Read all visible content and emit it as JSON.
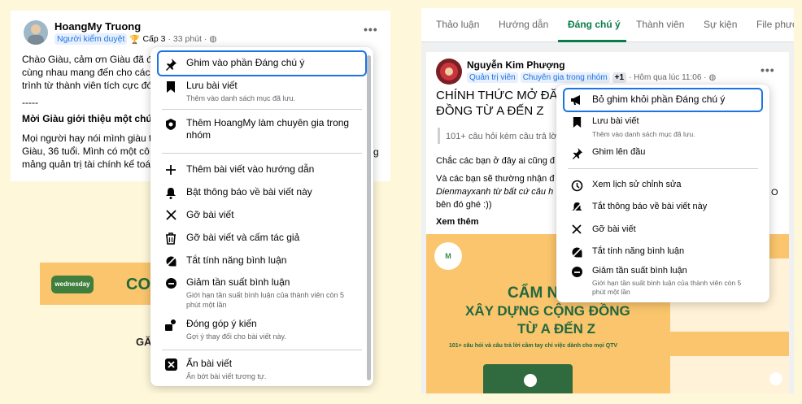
{
  "left": {
    "author": "HoangMy Truong",
    "role_badge": "Người kiểm duyệt",
    "level": "Cấp 3",
    "time": "· 33 phút ·",
    "body_lines": [
      "Chào Giàu, cảm ơn Giàu đã đ",
      "cùng nhau mang đến cho các",
      "trình từ thành viên tích cực đó"
    ],
    "divider": "-----",
    "intro_heading": "Mời Giàu giới thiệu một chút",
    "intro_lines": [
      "Mọi người hay nói mình giàu t",
      "Giàu, 36 tuổi. Mình có một cô",
      "mảng quản trị tài chính kế toá"
    ],
    "overflow_char": "g",
    "art_badge": "wednesday",
    "art_text": "CO",
    "art_text2": "GĂ",
    "menu": [
      {
        "icon": "pin-icon",
        "label": "Ghim vào phần Đáng chú ý",
        "sub": ""
      },
      {
        "icon": "bookmark-icon",
        "label": "Lưu bài viết",
        "sub": "Thêm vào danh sách mục đã lưu."
      },
      {
        "icon": "expert-badge-icon",
        "label": "Thêm HoangMy làm chuyên gia trong nhóm",
        "sub": ""
      },
      {
        "icon": "plus-icon",
        "label": "Thêm bài viết vào hướng dẫn",
        "sub": ""
      },
      {
        "icon": "bell-icon",
        "label": "Bật thông báo về bài viết này",
        "sub": ""
      },
      {
        "icon": "x-icon",
        "label": "Gỡ bài viết",
        "sub": ""
      },
      {
        "icon": "trash-icon",
        "label": "Gỡ bài viết và cấm tác giả",
        "sub": ""
      },
      {
        "icon": "comment-off-icon",
        "label": "Tắt tính năng bình luận",
        "sub": ""
      },
      {
        "icon": "slow-comment-icon",
        "label": "Giảm tần suất bình luận",
        "sub": "Giới hạn tần suất bình luận của thành viên còn 5 phút một lần"
      },
      {
        "icon": "feedback-icon",
        "label": "Đóng góp ý kiến",
        "sub": "Gợi ý thay đổi cho bài viết này."
      },
      {
        "icon": "hide-icon",
        "label": "Ẩn bài viết",
        "sub": "Ẩn bớt bài viết tương tự."
      }
    ]
  },
  "right": {
    "tabs": [
      "Thảo luận",
      "Hướng dẫn",
      "Đáng chú ý",
      "Thành viên",
      "Sự kiện",
      "File phươ"
    ],
    "author": "Nguyễn Kim Phượng",
    "role_badge": "Quản trị viên",
    "expert_badge": "Chuyên gia trong nhóm",
    "plus_count": "+1",
    "time": "· Hôm qua lúc 11:06 ·",
    "title_lines": [
      "CHÍNH THỨC MỞ ĐĂN",
      "ĐỒNG TỪ A ĐẾN Z"
    ],
    "quote": "101+ câu hỏi kèm câu trả lờ",
    "p1": "Chắc các bạn ở đây ai cũng đ",
    "p2_lines": [
      "Và các bạn sẽ thường nhận đ",
      "Dienmayxanh từ bất cứ câu h",
      "bên đó ghé :))"
    ],
    "overflow_o": "O",
    "see_more": "Xem thêm",
    "art_l1": "CẨM NA",
    "art_l2": "XÂY DỰNG CỘNG ĐỒNG",
    "art_l3": "TỪ A ĐẾN Z",
    "art_sub": "101+ câu hỏi và câu trả lời cầm tay chỉ việc dành cho mọi QTV",
    "menu": [
      {
        "icon": "megaphone-icon",
        "label": "Bỏ ghim khỏi phần Đáng chú ý",
        "sub": ""
      },
      {
        "icon": "bookmark-icon",
        "label": "Lưu bài viết",
        "sub": "Thêm vào danh sách mục đã lưu."
      },
      {
        "icon": "pin-icon",
        "label": "Ghim lên đầu",
        "sub": ""
      },
      {
        "icon": "history-icon",
        "label": "Xem lịch sử chỉnh sửa",
        "sub": ""
      },
      {
        "icon": "bell-off-icon",
        "label": "Tắt thông báo về bài viết này",
        "sub": ""
      },
      {
        "icon": "x-icon",
        "label": "Gỡ bài viết",
        "sub": ""
      },
      {
        "icon": "comment-off-icon",
        "label": "Tắt tính năng bình luận",
        "sub": ""
      },
      {
        "icon": "slow-comment-icon",
        "label": "Giảm tần suất bình luận",
        "sub": "Giới hạn tần suất bình luận của thành viên còn 5 phút một lần"
      }
    ]
  },
  "colors": {
    "accent": "#1b74e4",
    "green": "#0a7c4a",
    "background": "#fff7d9",
    "art": "#fac56c"
  }
}
